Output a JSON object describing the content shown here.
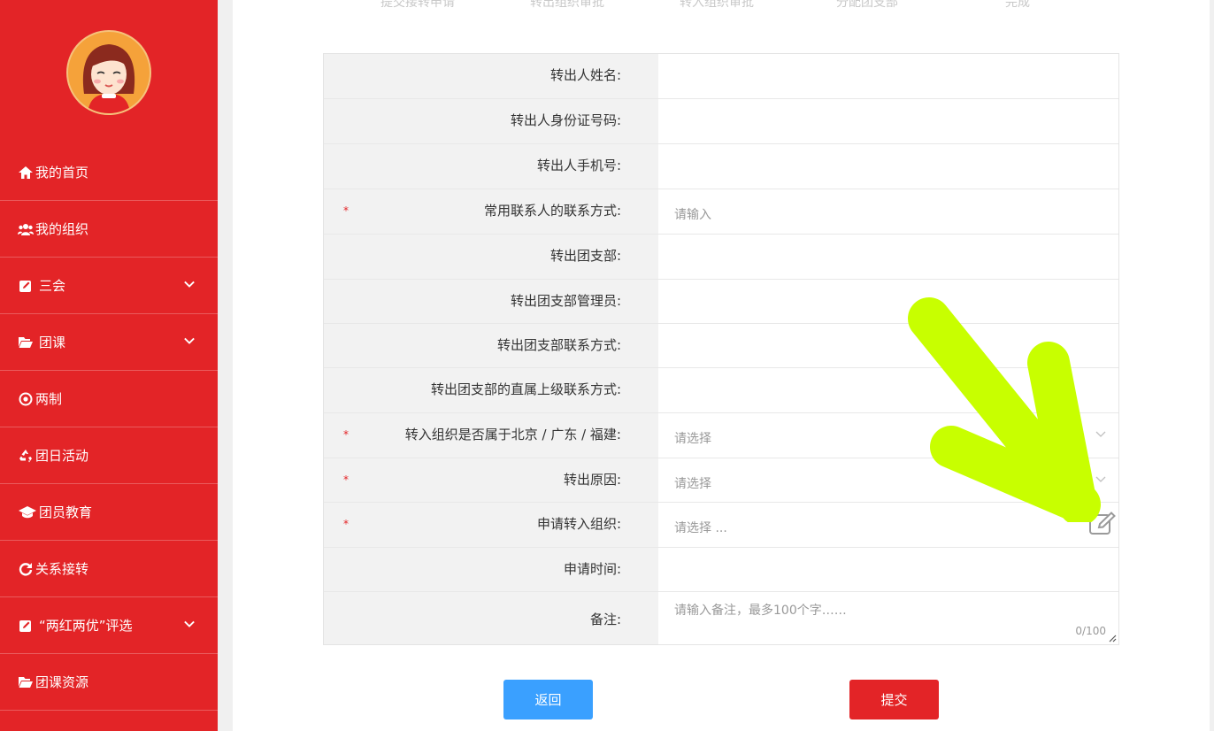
{
  "colors": {
    "sidebar": "#e32427",
    "primary": "#3aa0ff",
    "danger": "#e32427",
    "arrow": "#c8ff00"
  },
  "steps": [
    "提交接转申请",
    "转出组织审批",
    "转入组织审批",
    "分配团支部",
    "完成"
  ],
  "sidebar": {
    "items": [
      {
        "icon": "home-icon",
        "label": "我的首页",
        "has_submenu": false
      },
      {
        "icon": "users-icon",
        "label": "我的组织",
        "has_submenu": false
      },
      {
        "icon": "edit-icon",
        "label": "三会",
        "has_submenu": true
      },
      {
        "icon": "folder-open-icon",
        "label": "团课",
        "has_submenu": true
      },
      {
        "icon": "target-icon",
        "label": "两制",
        "has_submenu": false
      },
      {
        "icon": "recycle-icon",
        "label": "团日活动",
        "has_submenu": false
      },
      {
        "icon": "graduation-cap-icon",
        "label": "团员教育",
        "has_submenu": false
      },
      {
        "icon": "refresh-icon",
        "label": "关系接转",
        "has_submenu": false
      },
      {
        "icon": "edit-icon",
        "label": "“两红两优”评选",
        "has_submenu": true
      },
      {
        "icon": "folder-open-icon",
        "label": "团课资源",
        "has_submenu": false
      }
    ]
  },
  "form": {
    "rows": [
      {
        "label": "转出人姓名:",
        "required": false,
        "type": "text",
        "placeholder": ""
      },
      {
        "label": "转出人身份证号码:",
        "required": false,
        "type": "text",
        "placeholder": ""
      },
      {
        "label": "转出人手机号:",
        "required": false,
        "type": "text",
        "placeholder": ""
      },
      {
        "label": "常用联系人的联系方式:",
        "required": true,
        "type": "input",
        "placeholder": "请输入"
      },
      {
        "label": "转出团支部:",
        "required": false,
        "type": "text",
        "placeholder": ""
      },
      {
        "label": "转出团支部管理员:",
        "required": false,
        "type": "text",
        "placeholder": ""
      },
      {
        "label": "转出团支部联系方式:",
        "required": false,
        "type": "text",
        "placeholder": ""
      },
      {
        "label": "转出团支部的直属上级联系方式:",
        "required": false,
        "type": "text",
        "placeholder": ""
      },
      {
        "label": "转入组织是否属于北京 / 广东 / 福建:",
        "required": true,
        "type": "select",
        "placeholder": "请选择"
      },
      {
        "label": "转出原因:",
        "required": true,
        "type": "select",
        "placeholder": "请选择"
      },
      {
        "label": "申请转入组织:",
        "required": true,
        "type": "picker",
        "placeholder": "请选择 ..."
      },
      {
        "label": "申请时间:",
        "required": false,
        "type": "text",
        "placeholder": ""
      },
      {
        "label": "备注:",
        "required": false,
        "type": "textarea",
        "placeholder": "请输入备注，最多100个字……",
        "counter": "0/100"
      }
    ],
    "required_mark": "*"
  },
  "buttons": {
    "back": "返回",
    "submit": "提交"
  }
}
